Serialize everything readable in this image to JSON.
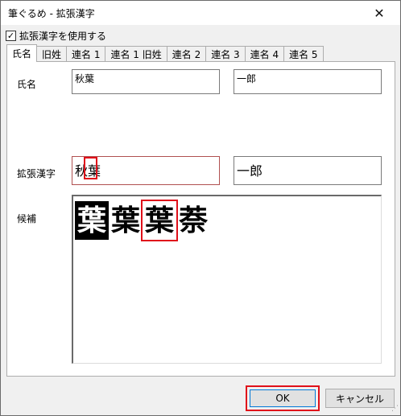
{
  "window": {
    "title": "筆ぐるめ - 拡張漢字",
    "close_glyph": "✕"
  },
  "option": {
    "checked": true,
    "check_glyph": "✓",
    "label": "拡張漢字を使用する"
  },
  "tabs": [
    {
      "label": "氏名",
      "active": true
    },
    {
      "label": "旧姓"
    },
    {
      "label": "連名 1"
    },
    {
      "label": "連名 1 旧姓"
    },
    {
      "label": "連名 2"
    },
    {
      "label": "連名 3"
    },
    {
      "label": "連名 4"
    },
    {
      "label": "連名 5"
    }
  ],
  "name": {
    "label": "氏名",
    "family_value": "秋葉",
    "given_value": "一郎"
  },
  "extended": {
    "label": "拡張漢字",
    "family_value": "秋葉",
    "given_value": "一郎"
  },
  "candidates": {
    "label": "候補",
    "items": [
      "葉",
      "葉",
      "葉",
      "萘"
    ],
    "selected_index": 0,
    "marked_index": 2
  },
  "buttons": {
    "ok": "OK",
    "cancel": "キャンセル"
  },
  "colors": {
    "highlight": "#e0101a",
    "focus_blue": "#0078d7"
  }
}
